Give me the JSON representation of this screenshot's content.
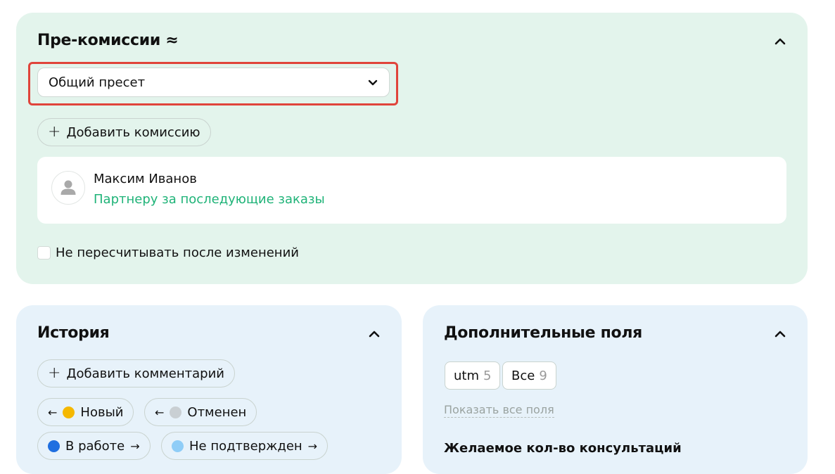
{
  "commissions": {
    "title": "Пре-комиссии ≈",
    "preset_value": "Общий пресет",
    "add_button": "Добавить комиссию",
    "user": {
      "name": "Максим Иванов",
      "role": "Партнеру за последующие заказы"
    },
    "recalc_checkbox_label": "Не пересчитывать после изменений"
  },
  "history": {
    "title": "История",
    "add_comment": "Добавить комментарий",
    "statuses": [
      {
        "label": "Новый",
        "color": "#f5b800"
      },
      {
        "label": "Отменен",
        "color": "#c9cfd3"
      },
      {
        "label": "В работе",
        "color": "#1f6fe0"
      },
      {
        "label": "Не подтвержден",
        "color": "#8fcdf7"
      }
    ]
  },
  "extra_fields": {
    "title": "Дополнительные поля",
    "chips": [
      {
        "label": "utm",
        "count": "5"
      },
      {
        "label": "Все",
        "count": "9"
      }
    ],
    "show_all": "Показать все поля",
    "field_label": "Желаемое кол-во консультаций"
  },
  "colors": {
    "green_card": "#e3f4ec",
    "blue_card": "#e7f2fa",
    "highlight": "#e0443b",
    "link_green": "#1fb378"
  },
  "icons": [
    "chevron-up-icon",
    "chevron-down-icon",
    "plus-icon",
    "user-icon",
    "arrow-left-icon",
    "arrow-right-icon"
  ]
}
